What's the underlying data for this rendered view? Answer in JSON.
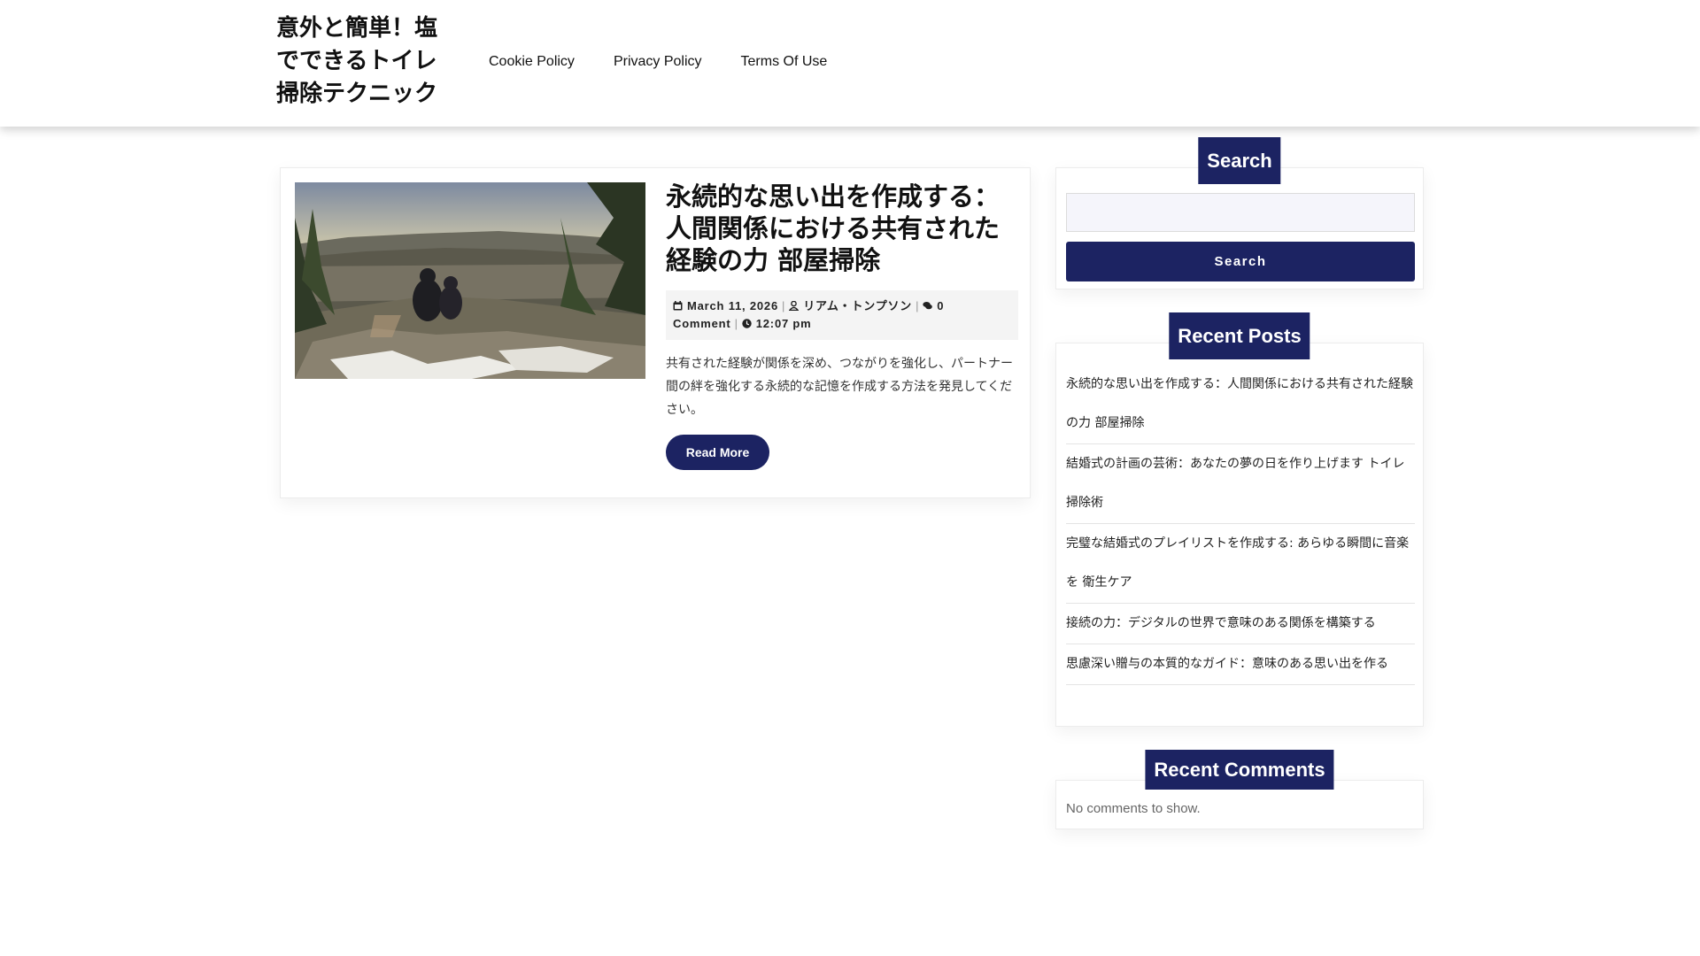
{
  "site": {
    "title": "意外と簡単！塩でできるトイレ掃除テクニック"
  },
  "nav": {
    "items": [
      "Cookie Policy",
      "Privacy Policy",
      "Terms Of Use"
    ]
  },
  "post": {
    "title": "永続的な思い出を作成する：人間関係における共有された経験の力 部屋掃除",
    "date": "March 11, 2026",
    "author": "リアム・トンプソン",
    "comments": "0 Comment",
    "time": "12:07 pm",
    "excerpt": "共有された経験が関係を深め、つながりを強化し、パートナー間の絆を強化する永続的な記憶を作成する方法を発見してください。",
    "read_more": "Read More",
    "image_icon": "landscape-photo"
  },
  "sidebar": {
    "search": {
      "title": "Search",
      "placeholder": "",
      "button": "Search"
    },
    "recent_posts": {
      "title": "Recent Posts",
      "items": [
        "永続的な思い出を作成する：人間関係における共有された経験の力 部屋掃除",
        "結婚式の計画の芸術：あなたの夢の日を作り上げます トイレ掃除術",
        "完璧な結婚式のプレイリストを作成する: あらゆる瞬間に音楽を 衛生ケア",
        "接続の力：デジタルの世界で意味のある関係を構築する",
        "思慮深い贈与の本質的なガイド：意味のある思い出を作る"
      ]
    },
    "recent_comments": {
      "title": "Recent Comments",
      "empty": "No comments to show."
    }
  },
  "colors": {
    "accent": "#1c2362",
    "meta_bg": "#f4f4f4"
  }
}
